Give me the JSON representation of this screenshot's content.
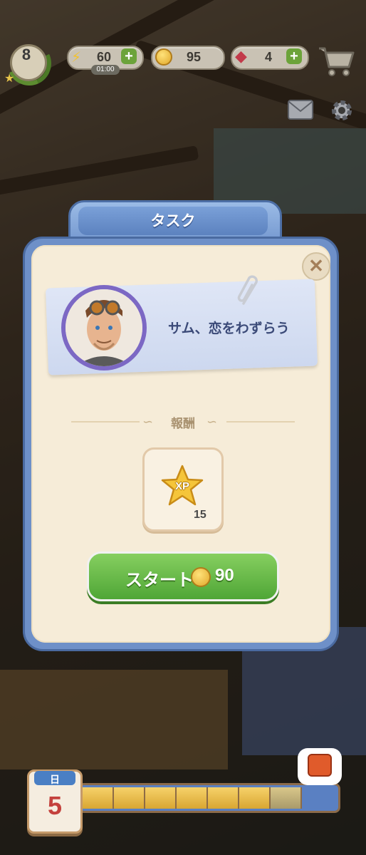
{
  "hud": {
    "level": "8",
    "energy": "60",
    "energy_timer": "01:00",
    "coins": "95",
    "gems": "4"
  },
  "dialog": {
    "title": "タスク",
    "task_name": "サム、恋をわずらう",
    "reward_label": "報酬",
    "reward_icon_text": "XP",
    "reward_count": "15",
    "start_label": "スタート",
    "start_cost": "90"
  },
  "day": {
    "label": "日",
    "number": "5",
    "progress_segments_filled": 7,
    "progress_segments_partial": 1,
    "progress_segments_total": 8
  },
  "colors": {
    "accent_blue": "#6e90c8",
    "start_green": "#4fa636",
    "parchment": "#f6ecd8"
  }
}
